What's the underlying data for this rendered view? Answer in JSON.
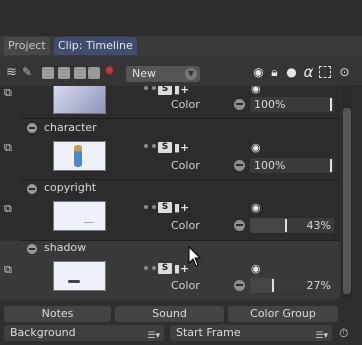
{
  "tabs": [
    {
      "label": "Project",
      "active": false
    },
    {
      "label": "Clip: Timeline",
      "active": true
    }
  ],
  "toolbar": {
    "icons": [
      "layers-icon",
      "bones-icon",
      "folder-icon",
      "folder-icon",
      "folder-icon",
      "folder-icon",
      "star-icon"
    ],
    "new_label": "New",
    "header_icons": [
      "eye-icon",
      "lock-icon",
      "bulb-icon",
      "alpha-icon",
      "select-icon",
      "target-icon"
    ],
    "alpha_glyph": "α"
  },
  "layers": [
    {
      "name": "",
      "attr": "Color",
      "value": "100%",
      "fraction": 1.0
    },
    {
      "name": "character",
      "attr": "Color",
      "value": "100%",
      "fraction": 1.0
    },
    {
      "name": "copyright",
      "attr": "Color",
      "value": "43%",
      "fraction": 0.43
    },
    {
      "name": "shadow",
      "attr": "Color",
      "value": "27%",
      "fraction": 0.27
    }
  ],
  "badge_s": "S",
  "bottom_buttons": {
    "notes": "Notes",
    "sound": "Sound",
    "color_group": "Color Group"
  },
  "bottom_selects": {
    "background": "Background",
    "start_frame": "Start Frame"
  },
  "colors": {
    "accent_tab": "#3e4d70",
    "background": "#2f2f2f"
  }
}
